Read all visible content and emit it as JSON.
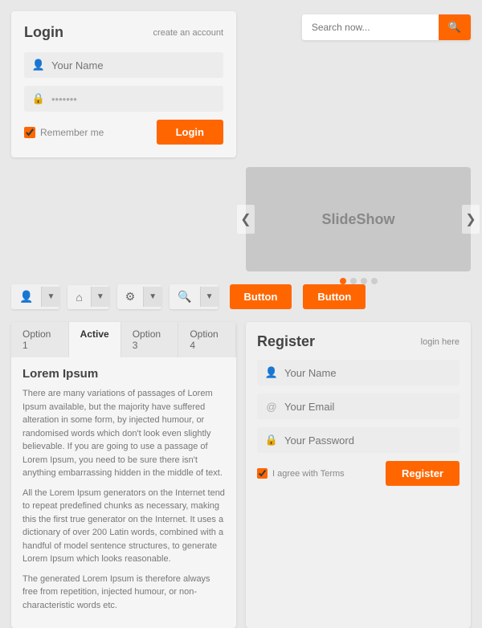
{
  "login": {
    "title": "Login",
    "create_account": "create an account",
    "name_placeholder": "Your Name",
    "password_placeholder": "•••••••",
    "remember_label": "Remember me",
    "login_btn": "Login"
  },
  "search": {
    "placeholder": "Search now...",
    "btn_icon": "🔍"
  },
  "slideshow": {
    "label": "SlideShow",
    "dots": [
      true,
      false,
      false,
      false
    ],
    "left_arrow": "❮",
    "right_arrow": "❯"
  },
  "toolbar": {
    "groups": [
      {
        "icon": "👤",
        "id": "user"
      },
      {
        "icon": "🏠",
        "id": "home"
      },
      {
        "icon": "⚙",
        "id": "gear"
      },
      {
        "icon": "🔍",
        "id": "search"
      }
    ],
    "btn1": "Button",
    "btn2": "Button"
  },
  "tabs": {
    "items": [
      {
        "label": "Option 1",
        "active": false
      },
      {
        "label": "Active",
        "active": true
      },
      {
        "label": "Option 3",
        "active": false
      },
      {
        "label": "Option 4",
        "active": false
      }
    ],
    "content_title": "Lorem Ipsum",
    "paragraphs": [
      "There are many variations of passages of Lorem Ipsum available, but the majority have suffered alteration in some form, by injected humour, or randomised words which don't look even slightly believable. If you are going to use a passage of Lorem Ipsum, you need to be sure there isn't anything embarrassing hidden in the middle of text.",
      "All the Lorem Ipsum generators on the Internet tend to repeat predefined chunks as necessary, making this the first true generator on the Internet. It uses a dictionary of over 200 Latin words, combined with a handful of model sentence structures, to generate Lorem Ipsum which looks reasonable.",
      "The generated Lorem Ipsum is therefore always free from repetition, injected humour, or non-characteristic words etc."
    ]
  },
  "register": {
    "title": "Register",
    "login_here": "login here",
    "name_placeholder": "Your Name",
    "email_placeholder": "Your Email",
    "password_placeholder": "Your Password",
    "agree_label": "I agree with Terms",
    "register_btn": "Register"
  }
}
